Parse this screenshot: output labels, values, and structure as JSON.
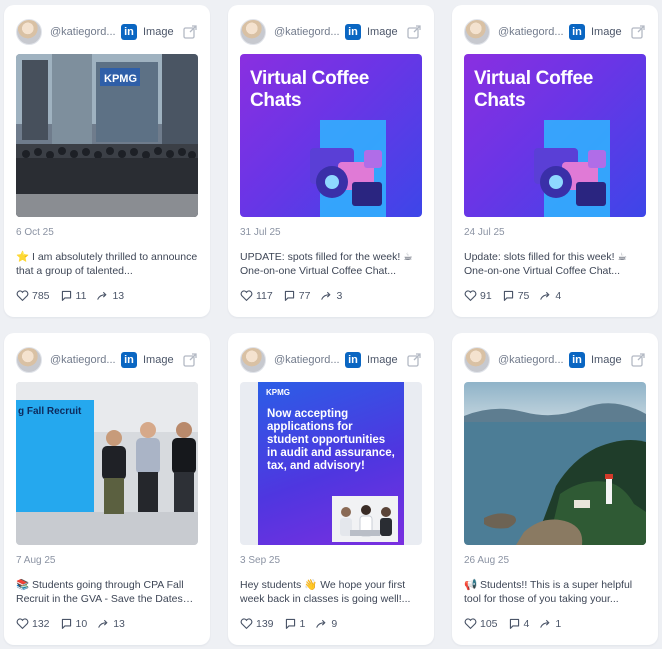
{
  "posts": [
    {
      "handle": "@katiegord...",
      "type": "Image",
      "date": "6 Oct 25",
      "text": "⭐ I am absolutely thrilled to announce that a group of talented...",
      "likes": "785",
      "comments": "11",
      "shares": "13",
      "image": {
        "kind": "group-photo",
        "sign": "KPMG"
      }
    },
    {
      "handle": "@katiegord...",
      "type": "Image",
      "date": "31 Jul 25",
      "text": "UPDATE: spots filled for the week! ☕ One-on-one Virtual Coffee Chat...",
      "likes": "117",
      "comments": "77",
      "shares": "3",
      "image": {
        "kind": "coffee",
        "title": "Virtual Coffee Chats"
      }
    },
    {
      "handle": "@katiegord...",
      "type": "Image",
      "date": "24 Jul 25",
      "text": "Update: slots filled for this week! ☕ One-on-one Virtual Coffee Chat...",
      "likes": "91",
      "comments": "75",
      "shares": "4",
      "image": {
        "kind": "coffee",
        "title": "Virtual Coffee Chats"
      }
    },
    {
      "handle": "@katiegord...",
      "type": "Image",
      "date": "7 Aug 25",
      "text": "📚 Students going through CPA Fall Recruit in the GVA - Save the Dates fo...",
      "likes": "132",
      "comments": "10",
      "shares": "13",
      "image": {
        "kind": "recruit-photo",
        "banner": "g Fall Recruit"
      }
    },
    {
      "handle": "@katiegord...",
      "type": "Image",
      "date": "3 Sep 25",
      "text": "Hey students 👋 We hope your first week back in classes is going well!...",
      "likes": "139",
      "comments": "1",
      "shares": "9",
      "image": {
        "kind": "accepting",
        "brand": "KPMG",
        "headline": "Now accepting applications for student opportunities in audit and assurance, tax, and advisory!"
      }
    },
    {
      "handle": "@katiegord...",
      "type": "Image",
      "date": "26 Aug 25",
      "text": "📢 Students!! This is a super helpful tool for those of you taking your...",
      "likes": "105",
      "comments": "4",
      "shares": "1",
      "image": {
        "kind": "coast-photo"
      }
    }
  ],
  "colors": {
    "linkedin": "#0a66c2",
    "background": "#eef0f4",
    "card": "#ffffff"
  }
}
